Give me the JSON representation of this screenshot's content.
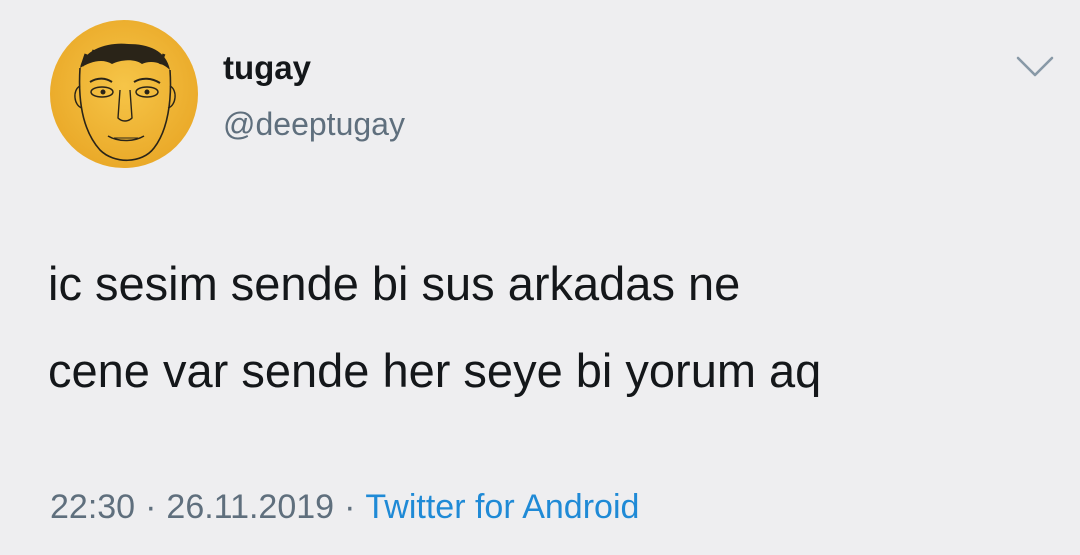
{
  "user": {
    "display_name": "tugay",
    "handle": "@deeptugay",
    "avatar_icon": "drawn-face-avatar",
    "avatar_bg": "#f2b632"
  },
  "menu": {
    "icon": "chevron-down-icon"
  },
  "tweet": {
    "lines": [
      "ic sesim sende bi sus arkadas ne",
      "cene var sende her seye bi yorum aq"
    ]
  },
  "meta": {
    "time": "22:30",
    "separator": "·",
    "date": "26.11.2019",
    "source": "Twitter for Android"
  },
  "colors": {
    "background": "#eeeef0",
    "text": "#14171a",
    "secondary": "#5f6f7d",
    "link": "#1f8ad6"
  }
}
